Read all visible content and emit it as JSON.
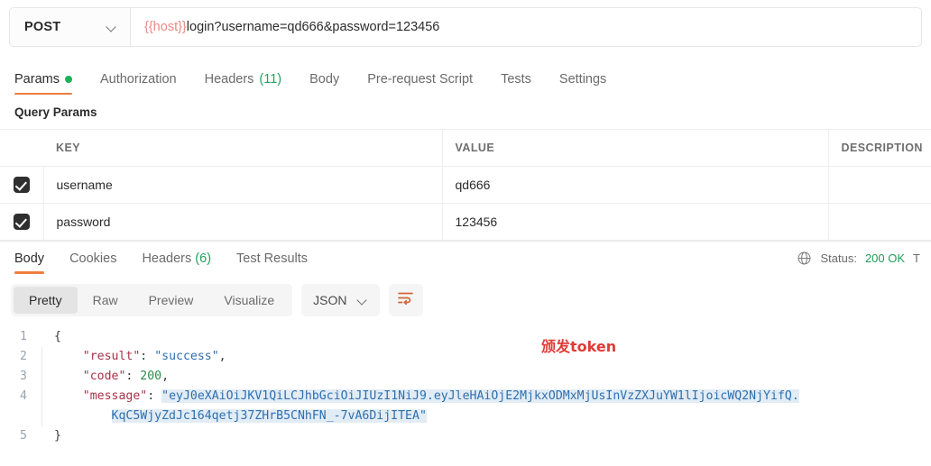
{
  "request": {
    "method": "POST",
    "method_chevron_icon": "chevron-down-icon",
    "url_variable": "{{host}}",
    "url_path": "login?username=qd666&password=123456"
  },
  "request_tabs": [
    {
      "label": "Params",
      "active": true,
      "dot": true,
      "count": ""
    },
    {
      "label": "Authorization",
      "active": false,
      "dot": false,
      "count": ""
    },
    {
      "label": "Headers",
      "active": false,
      "dot": false,
      "count": "(11)"
    },
    {
      "label": "Body",
      "active": false,
      "dot": false,
      "count": ""
    },
    {
      "label": "Pre-request Script",
      "active": false,
      "dot": false,
      "count": ""
    },
    {
      "label": "Tests",
      "active": false,
      "dot": false,
      "count": ""
    },
    {
      "label": "Settings",
      "active": false,
      "dot": false,
      "count": ""
    }
  ],
  "query_params": {
    "title": "Query Params",
    "columns": [
      "KEY",
      "VALUE",
      "DESCRIPTION"
    ],
    "rows": [
      {
        "checked": true,
        "key": "username",
        "value": "qd666",
        "description": ""
      },
      {
        "checked": true,
        "key": "password",
        "value": "123456",
        "description": ""
      }
    ]
  },
  "response_tabs": [
    {
      "label": "Body",
      "active": true,
      "count": ""
    },
    {
      "label": "Cookies",
      "active": false,
      "count": ""
    },
    {
      "label": "Headers",
      "active": false,
      "count": "(6)"
    },
    {
      "label": "Test Results",
      "active": false,
      "count": ""
    }
  ],
  "response_status": {
    "globe_icon": "globe-icon",
    "status_label": "Status:",
    "status_value": "200 OK",
    "trailing": "T"
  },
  "format_bar": {
    "views": [
      {
        "label": "Pretty",
        "active": true
      },
      {
        "label": "Raw",
        "active": false
      },
      {
        "label": "Preview",
        "active": false
      },
      {
        "label": "Visualize",
        "active": false
      }
    ],
    "type_selected": "JSON",
    "type_chevron_icon": "chevron-down-icon",
    "wrap_icon": "wrap-text-icon"
  },
  "annotation": {
    "text": "颁发token",
    "color": "#e03b34"
  },
  "body_code": {
    "lines": [
      "1",
      "2",
      "3",
      "4",
      "5"
    ],
    "l1": "{",
    "l2_key": "\"result\"",
    "l2_colon": ": ",
    "l2_val": "\"success\"",
    "l2_comma": ",",
    "l3_key": "\"code\"",
    "l3_colon": ": ",
    "l3_val": "200",
    "l3_comma": ",",
    "l4_key": "\"message\"",
    "l4_colon": ": ",
    "l4_quote_open": "\"",
    "l4_token_part1": "eyJ0eXAiOiJKV1QiLCJhbGciOiJIUzI1NiJ9.eyJleHAiOjE2MjkxODMxMjUsInVzZXJuYW1lIjoicWQ2NjYifQ.",
    "l4_token_part2": "KqC5WjyZdJc164qetj37ZHrB5CNhFN_-7vA6DijITEA",
    "l4_quote_close": "\"",
    "l5": "}"
  },
  "colors": {
    "accent_orange": "#ef7d3f",
    "status_green": "#1c9e57",
    "dot_green": "#1bb35b",
    "variable_red": "#eb8a84",
    "json_key": "#a8324a",
    "json_string": "#2e6fb0",
    "json_number": "#2a8c4a",
    "selection": "#e2ecf5"
  }
}
